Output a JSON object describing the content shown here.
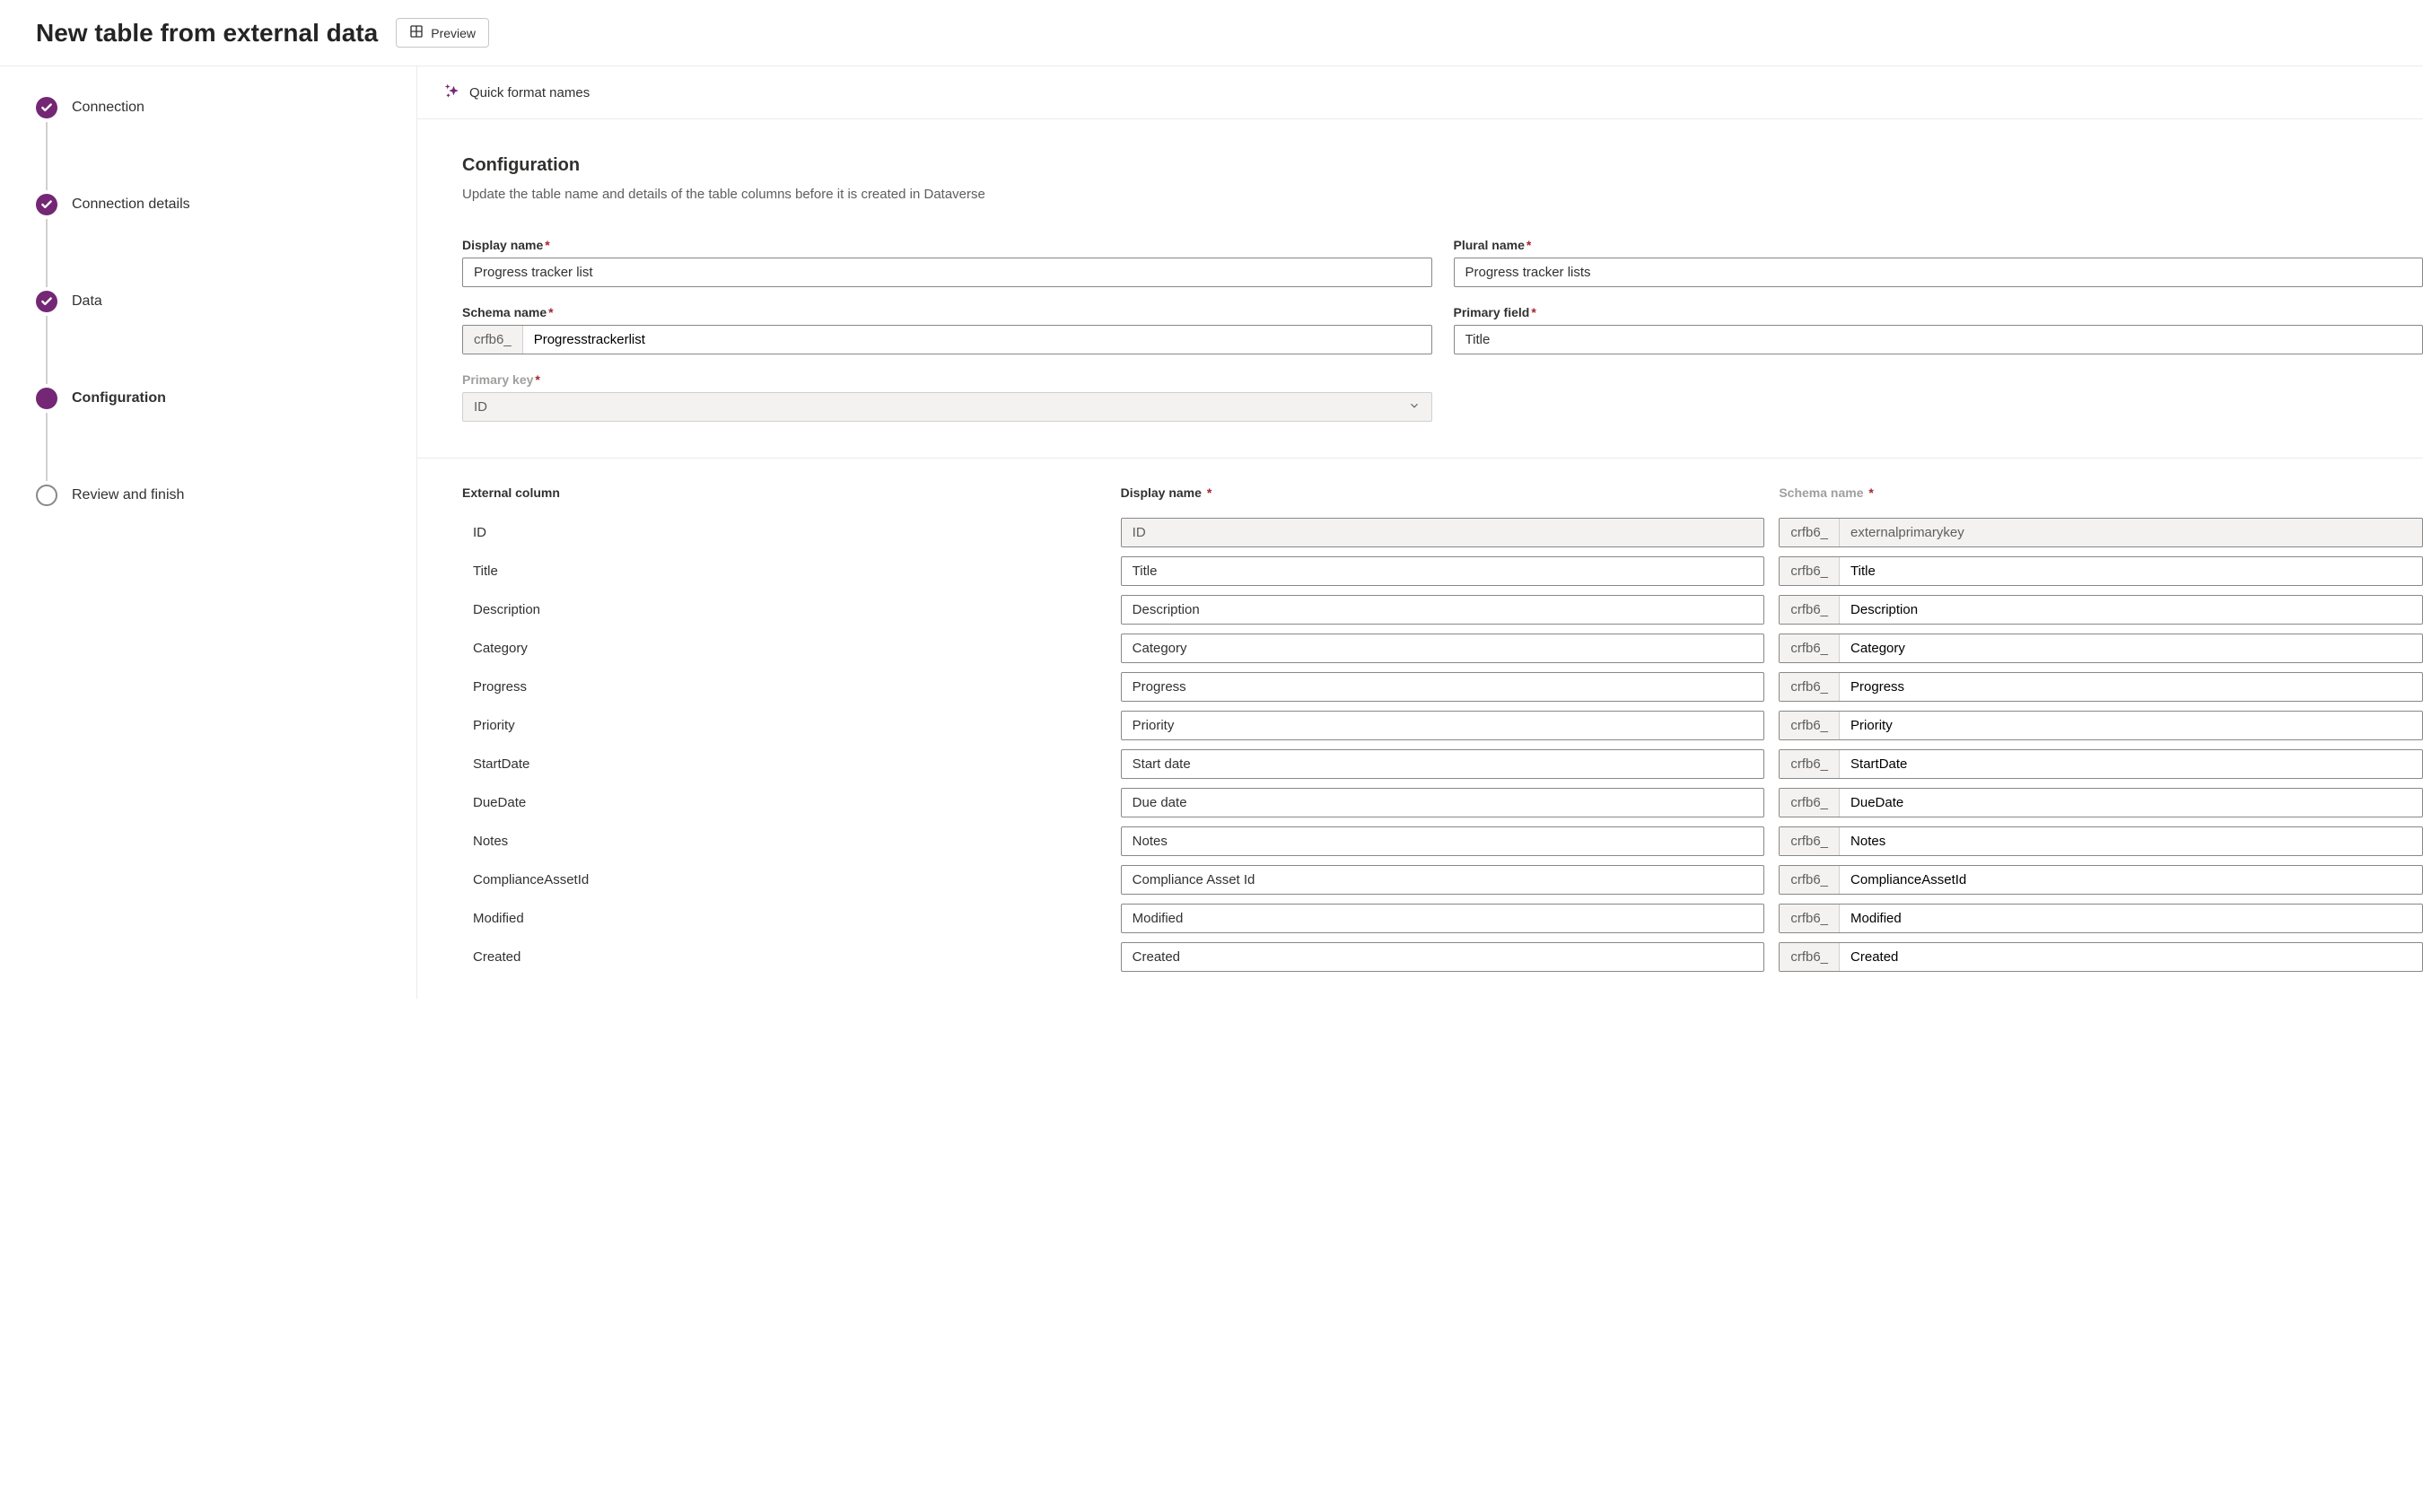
{
  "header": {
    "title": "New table from external data",
    "preview_label": "Preview"
  },
  "steps": [
    {
      "label": "Connection",
      "state": "done"
    },
    {
      "label": "Connection details",
      "state": "done"
    },
    {
      "label": "Data",
      "state": "done"
    },
    {
      "label": "Configuration",
      "state": "current"
    },
    {
      "label": "Review and finish",
      "state": "pending"
    }
  ],
  "toolbar": {
    "quick_format": "Quick format names"
  },
  "config": {
    "section_title": "Configuration",
    "section_desc": "Update the table name and details of the table columns before it is created in Dataverse",
    "labels": {
      "display_name": "Display name",
      "plural_name": "Plural name",
      "schema_name": "Schema name",
      "primary_field": "Primary field",
      "primary_key": "Primary key"
    },
    "values": {
      "display_name": "Progress tracker list",
      "plural_name": "Progress tracker lists",
      "schema_prefix": "crfb6_",
      "schema_name": "Progresstrackerlist",
      "primary_field": "Title",
      "primary_key": "ID"
    }
  },
  "columns": {
    "headers": {
      "external": "External column",
      "display": "Display name",
      "schema": "Schema name"
    },
    "schema_prefix": "crfb6_",
    "rows": [
      {
        "ext": "ID",
        "display": "ID",
        "schema": "externalprimarykey",
        "readonly": true
      },
      {
        "ext": "Title",
        "display": "Title",
        "schema": "Title"
      },
      {
        "ext": "Description",
        "display": "Description",
        "schema": "Description"
      },
      {
        "ext": "Category",
        "display": "Category",
        "schema": "Category"
      },
      {
        "ext": "Progress",
        "display": "Progress",
        "schema": "Progress"
      },
      {
        "ext": "Priority",
        "display": "Priority",
        "schema": "Priority"
      },
      {
        "ext": "StartDate",
        "display": "Start date",
        "schema": "StartDate"
      },
      {
        "ext": "DueDate",
        "display": "Due date",
        "schema": "DueDate"
      },
      {
        "ext": "Notes",
        "display": "Notes",
        "schema": "Notes"
      },
      {
        "ext": "ComplianceAssetId",
        "display": "Compliance Asset Id",
        "schema": "ComplianceAssetId"
      },
      {
        "ext": "Modified",
        "display": "Modified",
        "schema": "Modified"
      },
      {
        "ext": "Created",
        "display": "Created",
        "schema": "Created"
      }
    ]
  }
}
